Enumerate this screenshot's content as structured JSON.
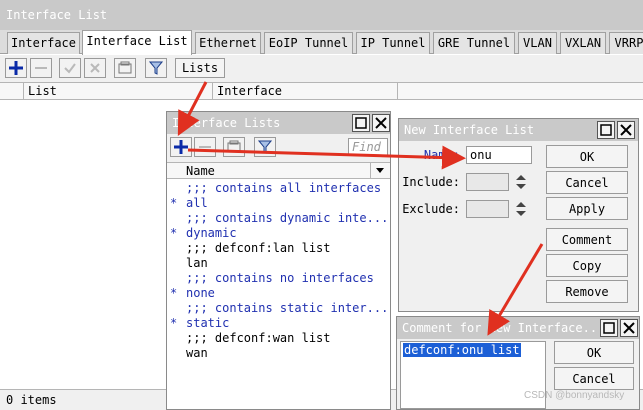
{
  "main": {
    "title": "Interface List",
    "tabs": [
      {
        "label": "Interface",
        "active": false
      },
      {
        "label": "Interface List",
        "active": true
      },
      {
        "label": "Ethernet",
        "active": false
      },
      {
        "label": "EoIP Tunnel",
        "active": false
      },
      {
        "label": "IP Tunnel",
        "active": false
      },
      {
        "label": "GRE Tunnel",
        "active": false
      },
      {
        "label": "VLAN",
        "active": false
      },
      {
        "label": "VXLAN",
        "active": false
      },
      {
        "label": "VRRP",
        "active": false
      }
    ],
    "toolbar": {
      "add_icon": "plus-icon",
      "remove_icon": "minus-icon",
      "enable_icon": "check-icon",
      "disable_icon": "x-icon",
      "comment_icon": "note-icon",
      "filter_icon": "funnel-icon",
      "lists_button": "Lists"
    },
    "columns": [
      "List",
      "Interface"
    ],
    "status": "0 items"
  },
  "interface_lists": {
    "title": "Interface Lists",
    "find_placeholder": "Find",
    "column": "Name",
    "rows": [
      {
        "mark": "",
        "text": ";;; contains all interfaces",
        "kind": "comment"
      },
      {
        "mark": "*",
        "text": "all",
        "kind": "star"
      },
      {
        "mark": "",
        "text": ";;; contains dynamic inte...",
        "kind": "comment"
      },
      {
        "mark": "*",
        "text": "dynamic",
        "kind": "star"
      },
      {
        "mark": "",
        "text": ";;; defconf:lan list",
        "kind": "list-name"
      },
      {
        "mark": "",
        "text": "lan",
        "kind": "list-name"
      },
      {
        "mark": "",
        "text": ";;; contains no interfaces",
        "kind": "comment"
      },
      {
        "mark": "*",
        "text": "none",
        "kind": "star"
      },
      {
        "mark": "",
        "text": ";;; contains static inter...",
        "kind": "comment"
      },
      {
        "mark": "*",
        "text": "static",
        "kind": "star"
      },
      {
        "mark": "",
        "text": ";;; defconf:wan list",
        "kind": "list-name"
      },
      {
        "mark": "",
        "text": "wan",
        "kind": "list-name"
      }
    ]
  },
  "new_list": {
    "title": "New Interface List",
    "name_label": "Name:",
    "name_value": "onu",
    "include_label": "Include:",
    "exclude_label": "Exclude:",
    "buttons": {
      "ok": "OK",
      "cancel": "Cancel",
      "apply": "Apply",
      "comment": "Comment",
      "copy": "Copy",
      "remove": "Remove"
    }
  },
  "comment_dialog": {
    "title": "Comment for New Interface...",
    "text": "defconf:onu list",
    "ok": "OK",
    "cancel": "Cancel"
  },
  "watermark": "CSDN @bonnyandsky",
  "colors": {
    "accent_arrow": "#e03020",
    "comment_blue": "#2030b0",
    "selection": "#1c5fd6"
  }
}
